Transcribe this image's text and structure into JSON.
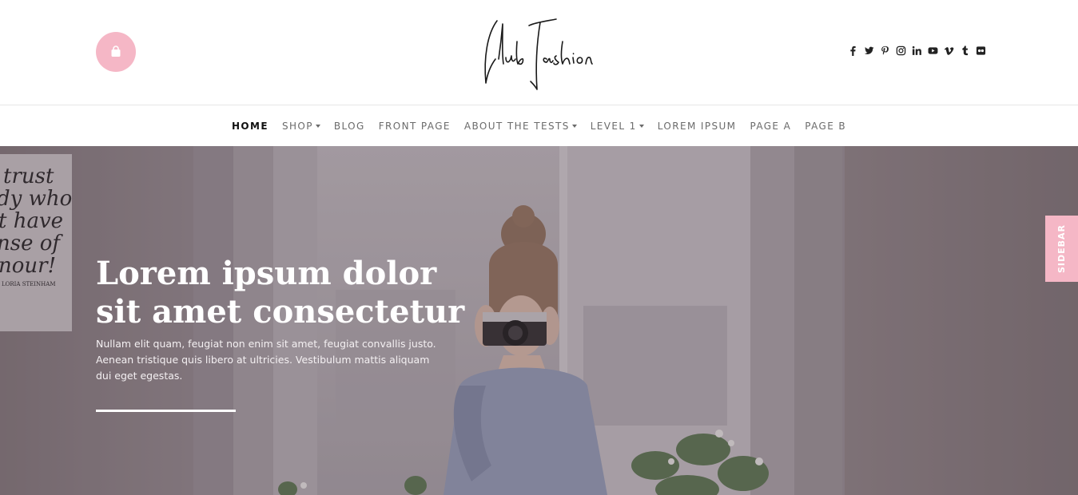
{
  "header": {
    "logo_text": "ClubFashion",
    "cart_icon": "shopping-bag-icon",
    "social": [
      "facebook-icon",
      "twitter-icon",
      "pinterest-icon",
      "instagram-icon",
      "linkedin-icon",
      "youtube-icon",
      "vimeo-icon",
      "tumblr-icon",
      "flickr-icon"
    ]
  },
  "nav": {
    "items": [
      {
        "label": "HOME",
        "active": true
      },
      {
        "label": "SHOP",
        "dropdown": true
      },
      {
        "label": "BLOG"
      },
      {
        "label": "FRONT PAGE"
      },
      {
        "label": "ABOUT THE TESTS",
        "dropdown": true
      },
      {
        "label": "LEVEL 1",
        "dropdown": true
      },
      {
        "label": "LOREM IPSUM"
      },
      {
        "label": "PAGE A"
      },
      {
        "label": "PAGE B"
      }
    ]
  },
  "hero": {
    "title": "Lorem ipsum dolor sit amet consectetur",
    "text": "Nullam elit quam, feugiat non enim sit amet, feugiat convallis justo. Aenean tristique quis libero at ultricies. Vestibulum mattis aliquam dui eget egestas.",
    "poster_text": "trust dy who t have nse of nour! LORIA STEINHAM"
  },
  "sidebar_tab": {
    "label": "SIDEBAR"
  },
  "colors": {
    "accent": "#f5b7c6",
    "nav_text": "#6b6b6b",
    "nav_active": "#111111"
  }
}
